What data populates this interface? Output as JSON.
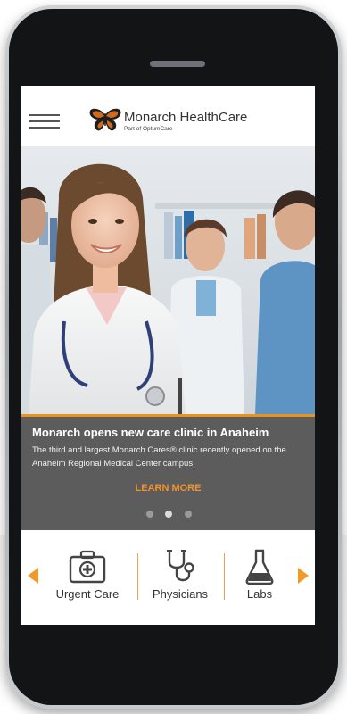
{
  "header": {
    "brand_name": "Monarch HealthCare",
    "brand_sub": "Part of OptumCare",
    "menu_icon": "hamburger-menu-icon",
    "logo_icon": "butterfly-logo-icon",
    "brand_color": "#d06a1f"
  },
  "news": {
    "title": "Monarch opens new care clinic in Anaheim",
    "body": "The third and largest Monarch Cares® clinic recently opened on the Anaheim Regional Medical Center campus.",
    "cta_label": "LEARN MORE",
    "slide_count": 3,
    "active_slide": 1
  },
  "quick_links": [
    {
      "label": "Urgent Care",
      "icon": "first-aid-kit-icon"
    },
    {
      "label": "Physicians",
      "icon": "stethoscope-icon"
    },
    {
      "label": "Labs",
      "icon": "lab-flask-icon"
    }
  ],
  "colors": {
    "accent": "#f1932a",
    "panel": "#5c5c5c"
  }
}
